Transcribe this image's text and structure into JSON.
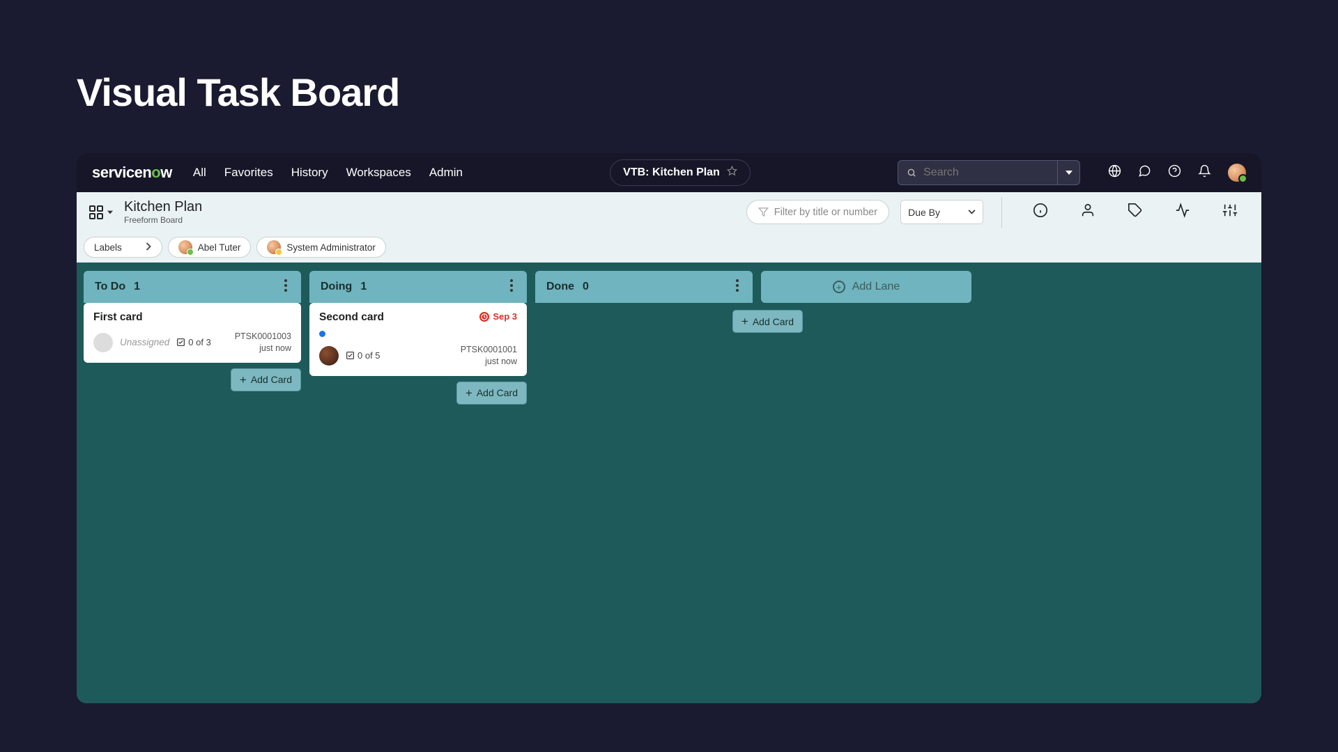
{
  "page_heading": "Visual Task Board",
  "brand": {
    "name_pre": "servicen",
    "name_o": "o",
    "name_post": "w"
  },
  "topnav": {
    "items": [
      "All",
      "Favorites",
      "History",
      "Workspaces",
      "Admin"
    ]
  },
  "breadcrumb_pill": "VTB: Kitchen Plan",
  "search_placeholder": "Search",
  "board": {
    "title": "Kitchen Plan",
    "subtitle": "Freeform Board",
    "filter_placeholder": "Filter by title or number",
    "due_by_label": "Due By",
    "labels_chip": "Labels",
    "people": [
      {
        "name": "Abel Tuter",
        "presence": "green"
      },
      {
        "name": "System Administrator",
        "presence": "gold"
      }
    ]
  },
  "lanes": [
    {
      "title": "To Do",
      "count": "1",
      "cards": [
        {
          "title": "First card",
          "assignee": "Unassigned",
          "assignee_empty": true,
          "checklist": "0 of 3",
          "id": "PTSK0001003",
          "time": "just now",
          "has_label_dot": false,
          "due": null
        }
      ]
    },
    {
      "title": "Doing",
      "count": "1",
      "cards": [
        {
          "title": "Second card",
          "assignee": "",
          "assignee_empty": false,
          "checklist": "0 of 5",
          "id": "PTSK0001001",
          "time": "just now",
          "has_label_dot": true,
          "due": "Sep 3"
        }
      ]
    },
    {
      "title": "Done",
      "count": "0",
      "cards": []
    }
  ],
  "add_lane_label": "Add Lane",
  "add_card_label": "Add Card"
}
